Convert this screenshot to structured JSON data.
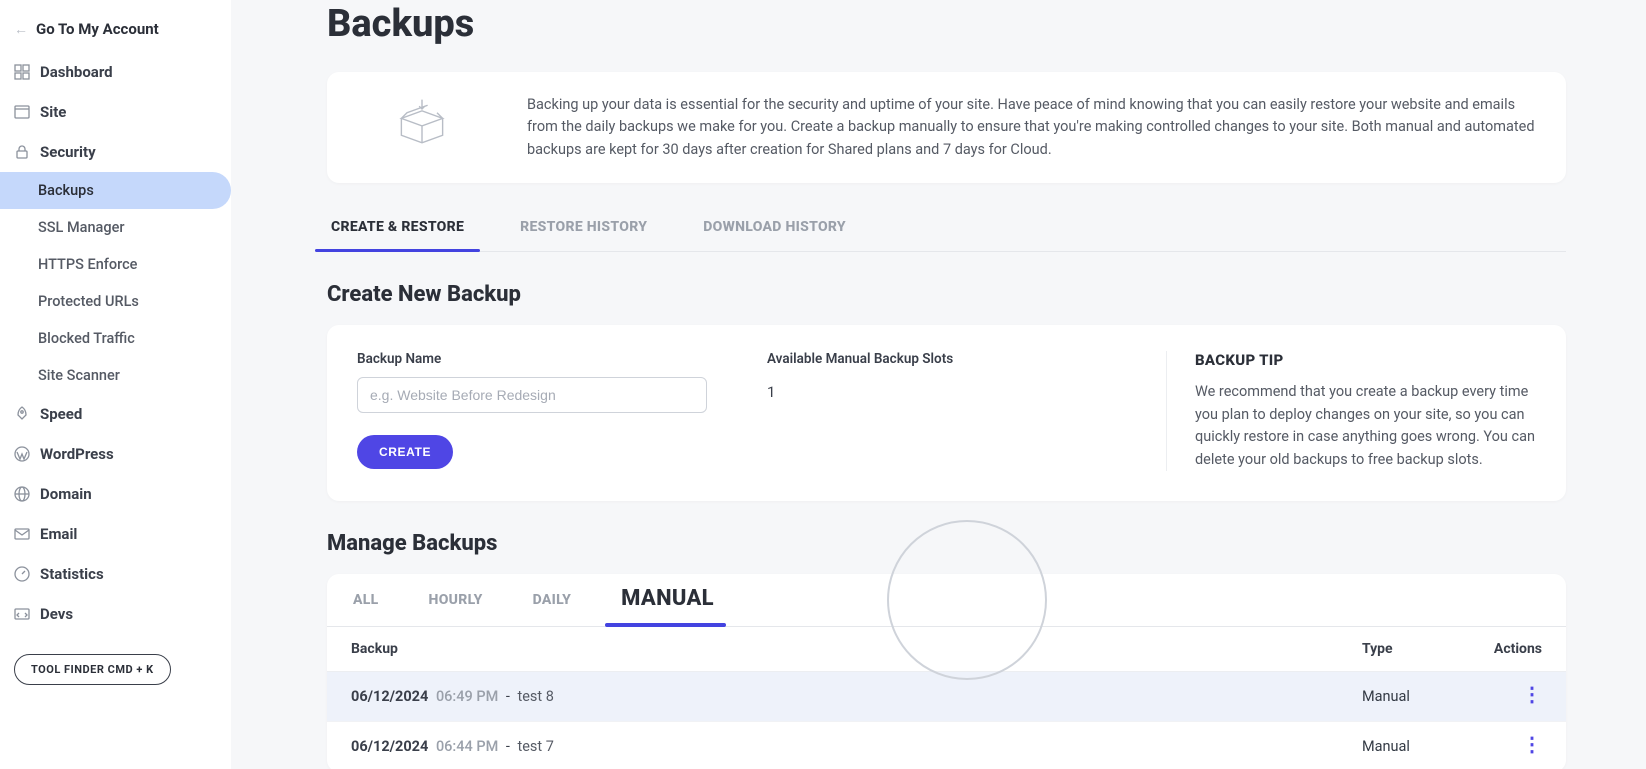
{
  "sidebar": {
    "go_account": "Go To My Account",
    "items": {
      "dashboard": "Dashboard",
      "site": "Site",
      "security": "Security",
      "speed": "Speed",
      "wordpress": "WordPress",
      "domain": "Domain",
      "email": "Email",
      "statistics": "Statistics",
      "devs": "Devs"
    },
    "security_sub": {
      "backups": "Backups",
      "ssl": "SSL Manager",
      "https": "HTTPS Enforce",
      "protected": "Protected URLs",
      "blocked": "Blocked Traffic",
      "scanner": "Site Scanner"
    },
    "tool_finder": "TOOL FINDER CMD + K"
  },
  "page": {
    "title": "Backups",
    "intro": "Backing up your data is essential for the security and uptime of your site. Have peace of mind knowing that you can easily restore your website and emails from the daily backups we make for you. Create a backup manually to ensure that you're making controlled changes to your site. Both manual and automated backups are kept for 30 days after creation for Shared plans and 7 days for Cloud."
  },
  "tabs": {
    "create_restore": "CREATE & RESTORE",
    "restore_history": "RESTORE HISTORY",
    "download_history": "DOWNLOAD HISTORY"
  },
  "create": {
    "section_title": "Create New Backup",
    "name_label": "Backup Name",
    "name_placeholder": "e.g. Website Before Redesign",
    "slots_label": "Available Manual Backup Slots",
    "slots_value": "1",
    "create_btn": "CREATE",
    "tip_title": "BACKUP TIP",
    "tip_text": "We recommend that you create a backup every time you plan to deploy changes on your site, so you can quickly restore in case anything goes wrong. You can delete your old backups to free backup slots."
  },
  "manage": {
    "section_title": "Manage Backups",
    "filters": {
      "all": "ALL",
      "hourly": "HOURLY",
      "daily": "DAILY",
      "manual": "MANUAL"
    },
    "columns": {
      "backup": "Backup",
      "type": "Type",
      "actions": "Actions"
    },
    "rows": [
      {
        "date": "06/12/2024",
        "time": "06:49 PM",
        "name": "test 8",
        "type": "Manual"
      },
      {
        "date": "06/12/2024",
        "time": "06:44 PM",
        "name": "test 7",
        "type": "Manual"
      }
    ]
  }
}
